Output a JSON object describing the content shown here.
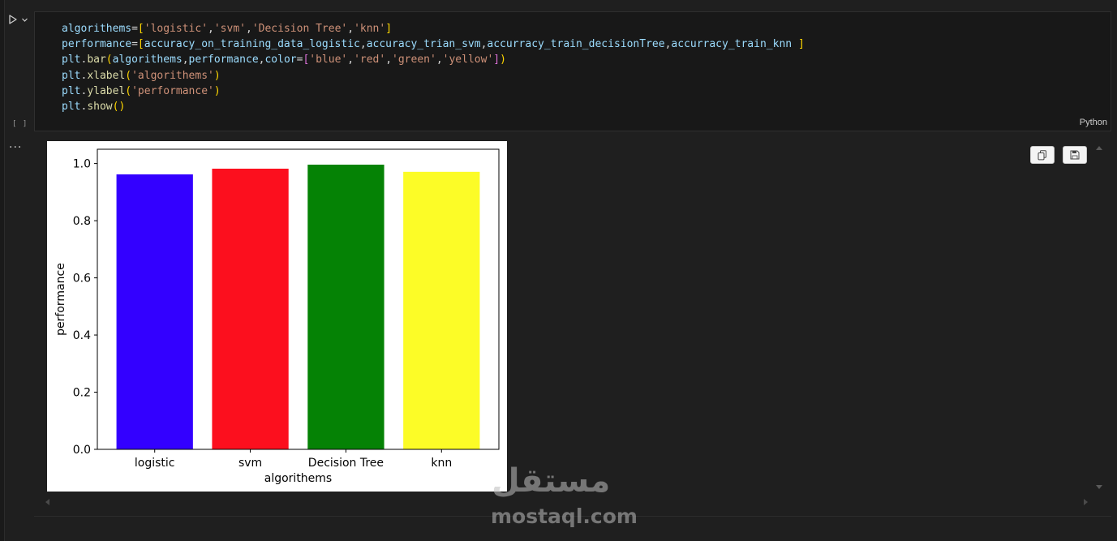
{
  "cell": {
    "code_lines": [
      [
        {
          "t": "algorithems",
          "c": "v"
        },
        {
          "t": "="
        },
        {
          "t": "[",
          "c": "b1"
        },
        {
          "t": "'logistic'",
          "c": "s"
        },
        {
          "t": ","
        },
        {
          "t": "'svm'",
          "c": "s"
        },
        {
          "t": ","
        },
        {
          "t": "'Decision Tree'",
          "c": "s"
        },
        {
          "t": ","
        },
        {
          "t": "'knn'",
          "c": "s"
        },
        {
          "t": "]",
          "c": "b1"
        }
      ],
      [
        {
          "t": "performance",
          "c": "v"
        },
        {
          "t": "="
        },
        {
          "t": "[",
          "c": "b1"
        },
        {
          "t": "accuracy_on_training_data_logistic",
          "c": "v"
        },
        {
          "t": ","
        },
        {
          "t": "accuracy_trian_svm",
          "c": "v"
        },
        {
          "t": ","
        },
        {
          "t": "accurracy_train_decisionTree",
          "c": "v"
        },
        {
          "t": ","
        },
        {
          "t": "accurracy_train_knn",
          "c": "v"
        },
        {
          "t": " "
        },
        {
          "t": "]",
          "c": "b1"
        }
      ],
      [
        {
          "t": "plt",
          "c": "v"
        },
        {
          "t": "."
        },
        {
          "t": "bar",
          "c": "f"
        },
        {
          "t": "(",
          "c": "b1"
        },
        {
          "t": "algorithems",
          "c": "v"
        },
        {
          "t": ","
        },
        {
          "t": "performance",
          "c": "v"
        },
        {
          "t": ","
        },
        {
          "t": "color",
          "c": "v"
        },
        {
          "t": "="
        },
        {
          "t": "[",
          "c": "b2"
        },
        {
          "t": "'blue'",
          "c": "s"
        },
        {
          "t": ","
        },
        {
          "t": "'red'",
          "c": "s"
        },
        {
          "t": ","
        },
        {
          "t": "'green'",
          "c": "s"
        },
        {
          "t": ","
        },
        {
          "t": "'yellow'",
          "c": "s"
        },
        {
          "t": "]",
          "c": "b2"
        },
        {
          "t": ")",
          "c": "b1"
        }
      ],
      [
        {
          "t": "plt",
          "c": "v"
        },
        {
          "t": "."
        },
        {
          "t": "xlabel",
          "c": "f"
        },
        {
          "t": "(",
          "c": "b1"
        },
        {
          "t": "'algorithems'",
          "c": "s"
        },
        {
          "t": ")",
          "c": "b1"
        }
      ],
      [
        {
          "t": "plt",
          "c": "v"
        },
        {
          "t": "."
        },
        {
          "t": "ylabel",
          "c": "f"
        },
        {
          "t": "(",
          "c": "b1"
        },
        {
          "t": "'performance'",
          "c": "s"
        },
        {
          "t": ")",
          "c": "b1"
        }
      ],
      [
        {
          "t": "plt",
          "c": "v"
        },
        {
          "t": "."
        },
        {
          "t": "show",
          "c": "f"
        },
        {
          "t": "()",
          "c": "b1"
        }
      ]
    ],
    "language": "Python",
    "execution_count": "[ ]",
    "output_prompt": "..."
  },
  "toolbar": {
    "run_icon": "play-icon",
    "run_menu_icon": "chevron-down-icon",
    "copy_icon": "copy-icon",
    "save_icon": "save-icon"
  },
  "chart_data": {
    "type": "bar",
    "categories": [
      "logistic",
      "svm",
      "Decision Tree",
      "knn"
    ],
    "values": [
      0.962,
      0.982,
      0.996,
      0.971
    ],
    "colors": [
      "#3300ff",
      "#fc0f1e",
      "#058205",
      "#fcfc27"
    ],
    "xlabel": "algorithems",
    "ylabel": "performance",
    "ylim": [
      0,
      1.05
    ],
    "yticks": [
      "0.0",
      "0.2",
      "0.4",
      "0.6",
      "0.8",
      "1.0"
    ],
    "grid": false
  },
  "watermark": {
    "arabic": "مستقل",
    "latin": "mostaql.com"
  }
}
